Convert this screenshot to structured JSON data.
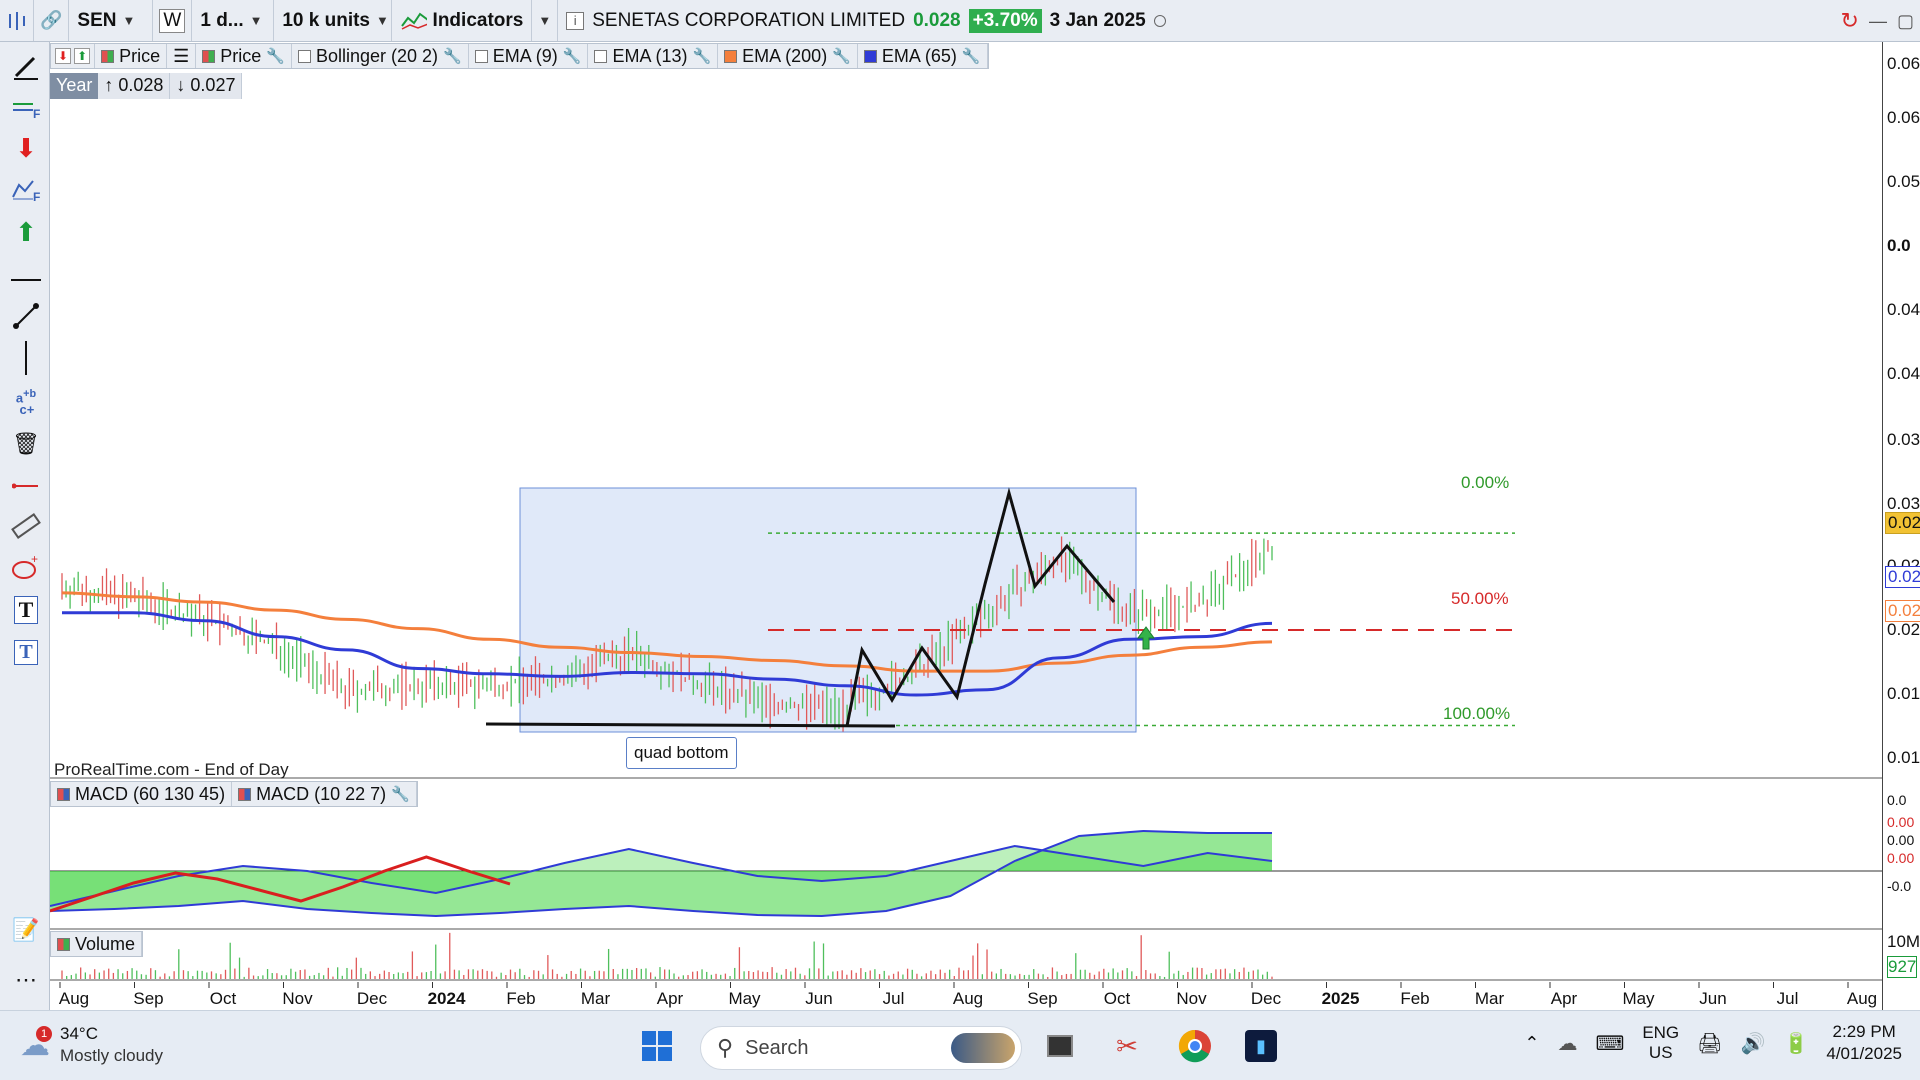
{
  "toolbar": {
    "symbol": "SEN",
    "watchlist_btn": "W",
    "interval": "1 d...",
    "units": "10 k units",
    "indicators_label": "Indicators",
    "instrument_name": "SENETAS CORPORATION LIMITED",
    "last_price": "0.028",
    "change_pct": "+3.70%",
    "date": "3 Jan 2025"
  },
  "legend": {
    "price_label": "Price",
    "price_label_2": "Price",
    "bollinger": "Bollinger (20 2)",
    "ema9": "EMA (9)",
    "ema13": "EMA (13)",
    "ema200": "EMA (200)",
    "ema65": "EMA (65)"
  },
  "year_box": {
    "label": "Year",
    "high": "↑ 0.028",
    "low": "↓ 0.027"
  },
  "source_label": "ProRealTime.com - End of Day",
  "annotation": {
    "quad_bottom": "quad bottom"
  },
  "fib": {
    "top": "0.00%",
    "mid": "50.00%",
    "bottom": "100.00%"
  },
  "macd_legend": {
    "macd1": "MACD (60 130 45)",
    "macd2": "MACD (10 22 7)"
  },
  "volume_legend": "Volume",
  "right_axis": {
    "labels": [
      "0.06",
      "0.06",
      "0.05",
      "0.0",
      "0.04",
      "0.04",
      "0.03",
      "0.03",
      "0.02",
      "0.02",
      "0.01",
      "0.01"
    ],
    "tags": [
      "0.02",
      "0.02",
      "0.02"
    ],
    "macd_labels": [
      "0.0",
      "0.00",
      "0.00",
      "0.00",
      "-0.0"
    ],
    "vol_labels": [
      "10M",
      "927"
    ]
  },
  "colors": {
    "ema200": "#f47f3c",
    "ema65": "#2f3bd6",
    "fib_line": "#3aaa35",
    "fib_mid": "#d62a2a",
    "highlight": "#dbe5f8",
    "macd_fill": "#3ed43e",
    "macd_red": "#d91f1f"
  },
  "chart_data": {
    "type": "line",
    "title": "SENETAS CORPORATION LIMITED",
    "x": [
      "Aug",
      "Sep",
      "Oct",
      "Nov",
      "Dec",
      "2024",
      "Feb",
      "Mar",
      "Apr",
      "May",
      "Jun",
      "Jul",
      "Aug",
      "Sep",
      "Oct",
      "Nov",
      "Dec",
      "2025",
      "Feb",
      "Mar",
      "Apr",
      "May",
      "Jun",
      "Jul",
      "Aug"
    ],
    "series": [
      {
        "name": "EMA (200)",
        "values": [
          0.0235,
          0.0232,
          0.0228,
          0.0222,
          0.0215,
          0.0208,
          0.02,
          0.0194,
          0.019,
          0.0187,
          0.0184,
          0.018,
          0.0176,
          0.0176,
          0.0182,
          0.0188,
          0.0194,
          0.0198
        ]
      },
      {
        "name": "EMA (65)",
        "values": [
          0.022,
          0.022,
          0.0214,
          0.0202,
          0.0192,
          0.0178,
          0.0174,
          0.0172,
          0.0175,
          0.0174,
          0.017,
          0.0165,
          0.0158,
          0.0162,
          0.0186,
          0.02,
          0.0202,
          0.0212
        ]
      }
    ],
    "ylim": [
      0.01,
      0.065
    ],
    "fib_levels": {
      "0.00%": 0.028,
      "50.00%": 0.0207,
      "100.00%": 0.0135
    },
    "grid": false,
    "legend": "top-left"
  }
}
